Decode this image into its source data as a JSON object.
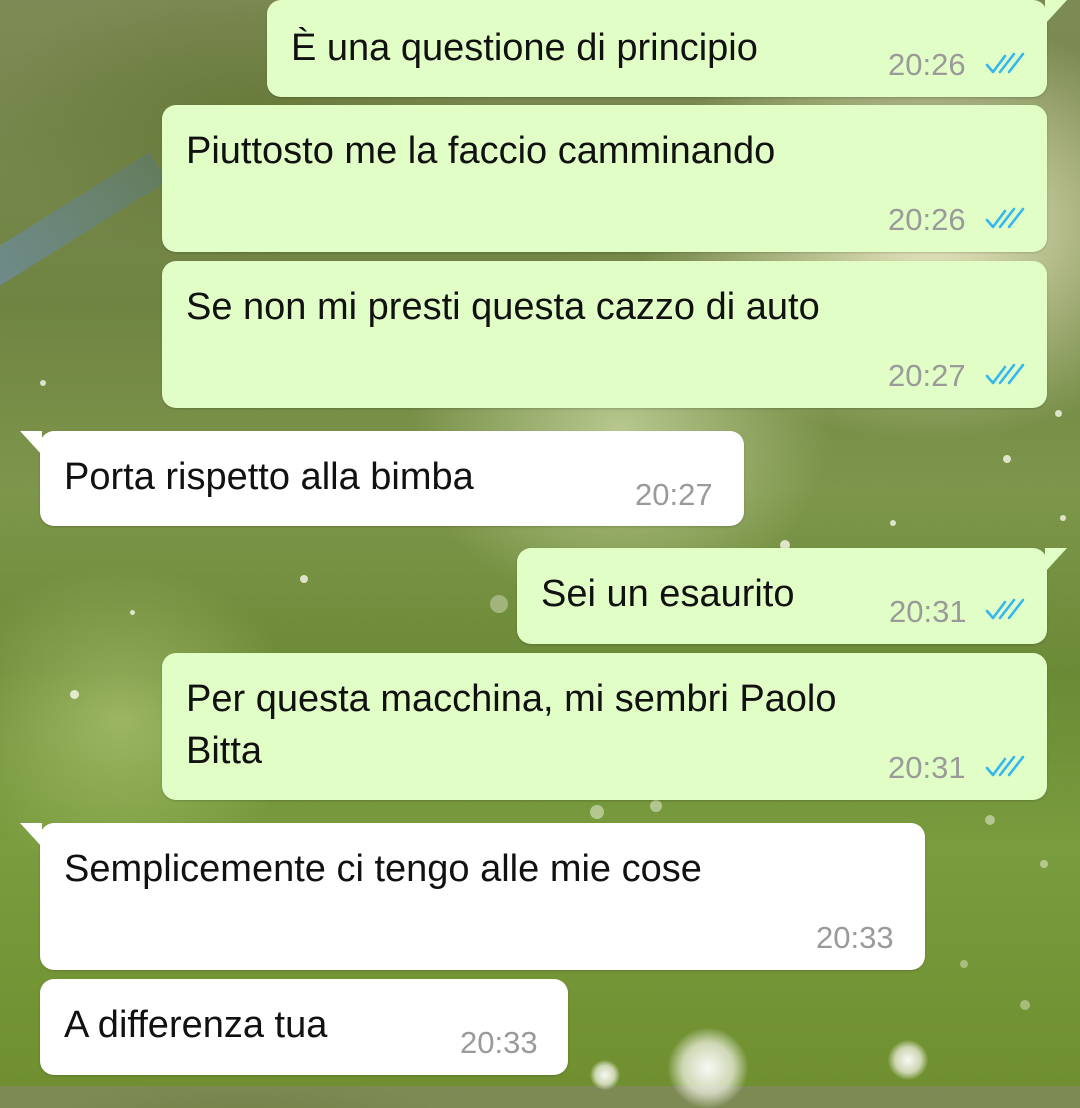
{
  "messages": [
    {
      "text": "È una questione di principio",
      "time": "20:26",
      "status_icon": "double-check-read-icon"
    },
    {
      "text": "Piuttosto me la faccio camminando",
      "time": "20:26",
      "status_icon": "double-check-read-icon"
    },
    {
      "text": "Se non mi presti questa cazzo di auto",
      "time": "20:27",
      "status_icon": "double-check-read-icon"
    },
    {
      "text": "Porta rispetto alla bimba",
      "time": "20:27"
    },
    {
      "text": "Sei un esaurito",
      "time": "20:31",
      "status_icon": "double-check-read-icon"
    },
    {
      "text_line1": "Per questa macchina, mi sembri Paolo",
      "text_line2": "Bitta",
      "time": "20:31",
      "status_icon": "double-check-read-icon"
    },
    {
      "text": "Semplicemente ci tengo alle mie cose",
      "time": "20:33"
    },
    {
      "text": "A differenza tua",
      "time": "20:33"
    }
  ],
  "colors": {
    "outgoing_bubble": "#e1fec6",
    "incoming_bubble": "#ffffff",
    "timestamp": "#9a9a9a",
    "read_check": "#34b7f1"
  }
}
